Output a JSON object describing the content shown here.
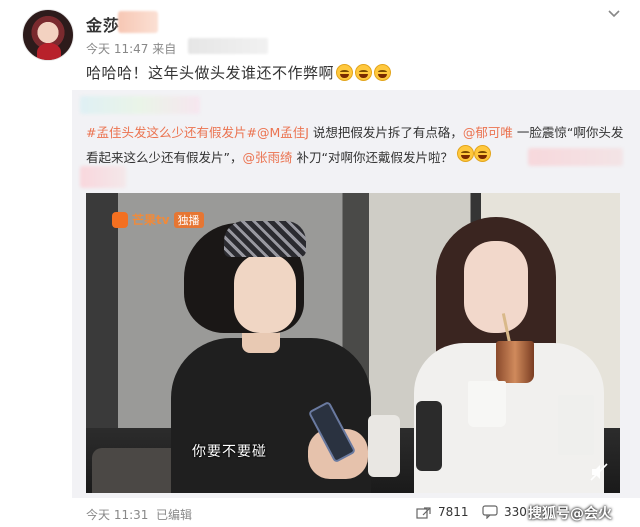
{
  "post": {
    "username": "金莎",
    "time": "今天 11:47",
    "source_prefix": "来自",
    "text": "哈哈哈！这年头做头发谁还不作弊啊",
    "emoji_count": 3
  },
  "repost": {
    "hashtag": "#孟佳头发这么少还有假发片#",
    "mention1": "@M孟佳J",
    "text1": " 说想把假发片拆了有点硌，",
    "mention2": "@郁可唯",
    "text2": " 一脸震惊“啊你头发看起来这么少还有假发片”，",
    "mention3": "@张雨绮",
    "text3": " 补刀“对啊你还戴假发片啦？",
    "link_color": "#eb7350"
  },
  "video": {
    "logo_text": "芒果tv",
    "logo_badge": "独播",
    "caption": "你要不要碰"
  },
  "footer": {
    "time": "今天 11:31",
    "edited": "已编辑",
    "share_count": "7811",
    "comment_count": "330"
  },
  "watermark": {
    "text": "搜狐号@会火"
  }
}
